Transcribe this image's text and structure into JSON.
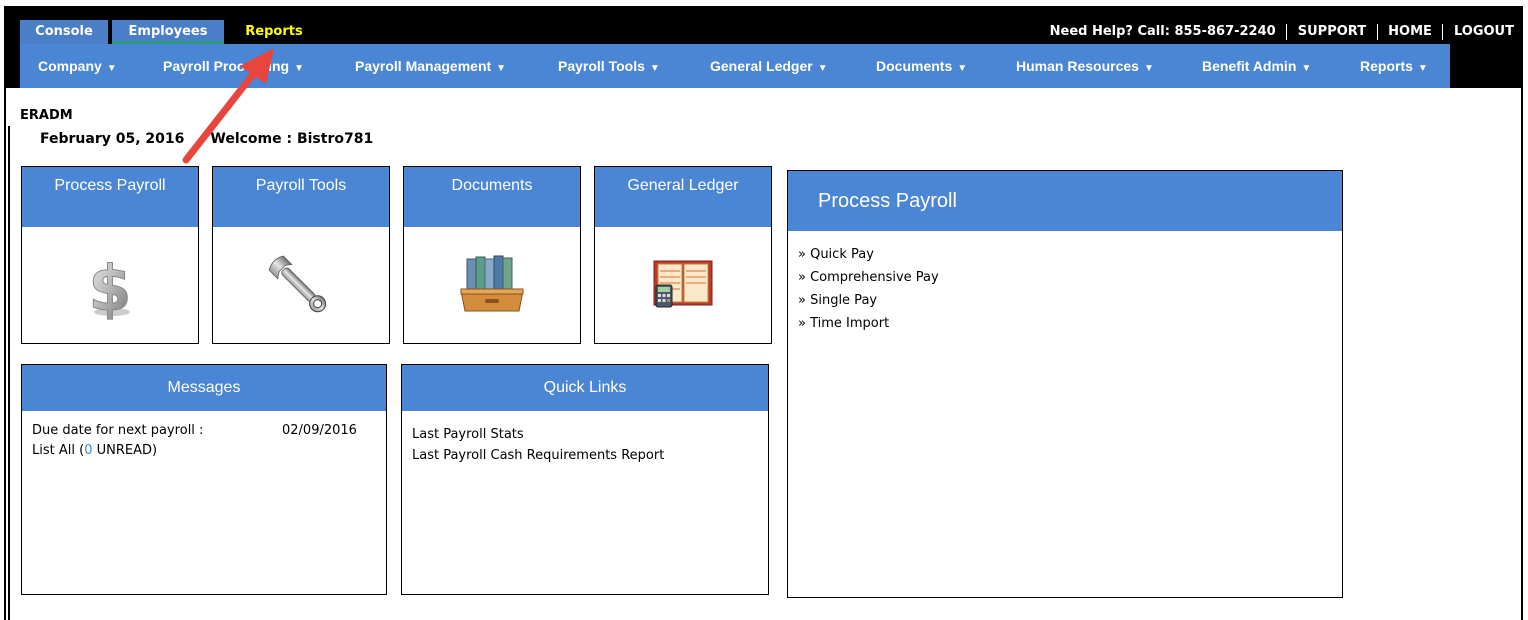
{
  "top_tabs": [
    "Console",
    "Employees",
    "Reports"
  ],
  "help": {
    "call_text": "Need Help? Call: 855-867-2240",
    "links": [
      "SUPPORT",
      "HOME",
      "LOGOUT"
    ]
  },
  "menu": [
    "Company",
    "Payroll Processing",
    "Payroll Management",
    "Payroll Tools",
    "General Ledger",
    "Documents",
    "Human Resources",
    "Benefit Admin",
    "Reports"
  ],
  "user": {
    "code": "ERADM",
    "date": "February 05, 2016",
    "welcome": "Welcome : Bistro781"
  },
  "tiles": [
    {
      "title": "Process Payroll",
      "icon": "dollar-icon"
    },
    {
      "title": "Payroll Tools",
      "icon": "wrench-icon"
    },
    {
      "title": "Documents",
      "icon": "binders-icon"
    },
    {
      "title": "General Ledger",
      "icon": "ledger-icon"
    }
  ],
  "messages": {
    "title": "Messages",
    "due_label": "Due date for next payroll :",
    "due_date": "02/09/2016",
    "list_all": "List All (",
    "unread_count": "0",
    "unread_suffix": " UNREAD)"
  },
  "quick_links": {
    "title": "Quick Links",
    "items": [
      "Last Payroll Stats",
      "Last Payroll Cash Requirements Report"
    ]
  },
  "process_payroll_panel": {
    "title": "Process Payroll",
    "items": [
      "» Quick Pay",
      "» Comprehensive Pay",
      "» Single Pay",
      "» Time Import"
    ]
  },
  "colors": {
    "accent_blue": "#4a86d4",
    "highlight_yellow": "#ffff00",
    "arrow_red": "#e8453c"
  }
}
